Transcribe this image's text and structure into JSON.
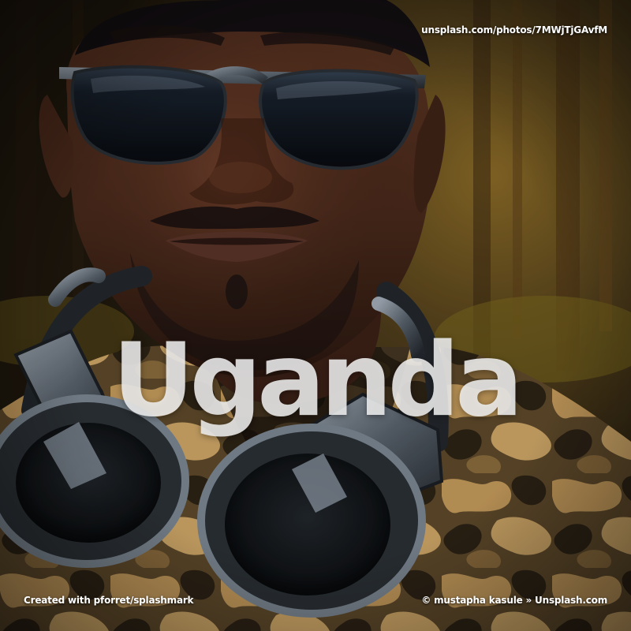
{
  "overlay": {
    "source_url": "unsplash.com/photos/7MWjTjGAvfM",
    "headline": "Uganda",
    "created_with": "Created with pforret/splashmark",
    "credit": "© mustapha kasule » Unsplash.com"
  },
  "photo": {
    "subject": "man-wearing-aviator-sunglasses-and-headphones",
    "colors": {
      "background_forest": "#3a2c16",
      "skin": "#4a2b1c",
      "lens": "#0d1118",
      "headphones": "#5d6670",
      "camo_tan": "#c59b5c",
      "camo_dark": "#2d2316"
    }
  }
}
